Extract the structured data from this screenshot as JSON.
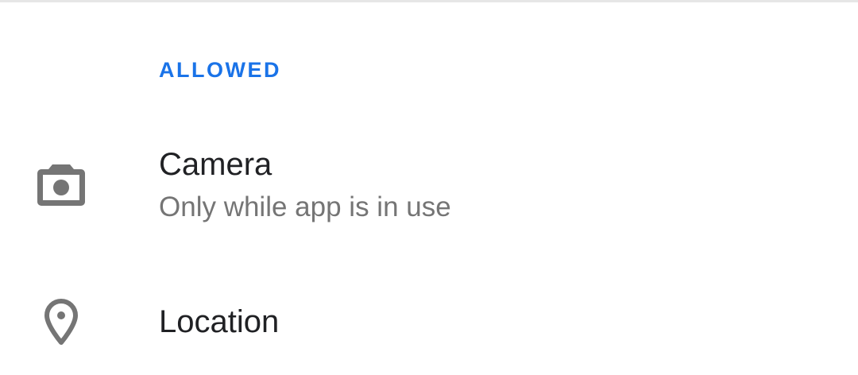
{
  "section": {
    "header": "ALLOWED"
  },
  "permissions": [
    {
      "title": "Camera",
      "summary": "Only while app is in use",
      "icon": "camera-icon"
    },
    {
      "title": "Location",
      "icon": "location-pin-icon"
    }
  ],
  "colors": {
    "accent": "#1a73e8",
    "title": "#202124",
    "summary": "#757575",
    "icon": "#757575",
    "divider": "#e6e6e6"
  }
}
